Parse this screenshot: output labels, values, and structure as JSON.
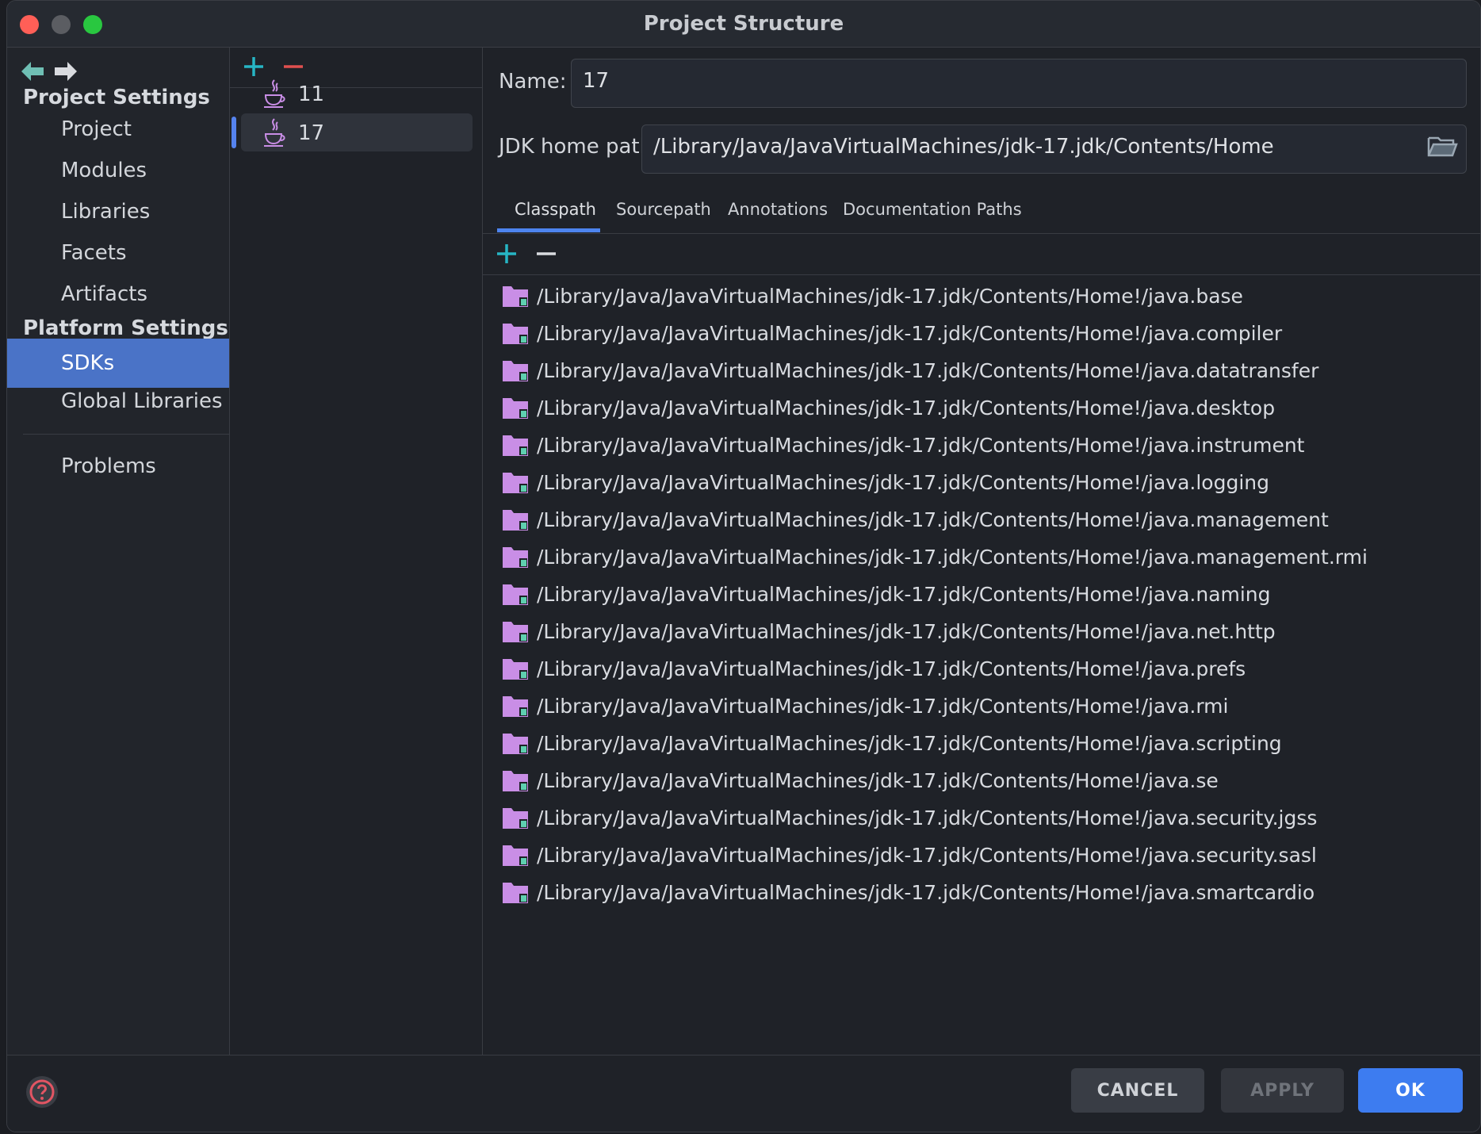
{
  "window": {
    "title": "Project Structure"
  },
  "sidebar": {
    "project_settings_heading": "Project Settings",
    "project_items": [
      "Project",
      "Modules",
      "Libraries",
      "Facets",
      "Artifacts"
    ],
    "platform_settings_heading": "Platform Settings",
    "platform_items": [
      "SDKs",
      "Global Libraries"
    ],
    "selected": "SDKs",
    "problems": "Problems"
  },
  "sdk_list": {
    "items": [
      "11",
      "17"
    ],
    "selected": "17"
  },
  "detail": {
    "name_label": "Name:",
    "name_value": "17",
    "jdk_home_label": "JDK home path:",
    "jdk_home_value": "/Library/Java/JavaVirtualMachines/jdk-17.jdk/Contents/Home",
    "tabs": [
      "Classpath",
      "Sourcepath",
      "Annotations",
      "Documentation Paths"
    ],
    "active_tab": "Classpath",
    "classpath": [
      "/Library/Java/JavaVirtualMachines/jdk-17.jdk/Contents/Home!/java.base",
      "/Library/Java/JavaVirtualMachines/jdk-17.jdk/Contents/Home!/java.compiler",
      "/Library/Java/JavaVirtualMachines/jdk-17.jdk/Contents/Home!/java.datatransfer",
      "/Library/Java/JavaVirtualMachines/jdk-17.jdk/Contents/Home!/java.desktop",
      "/Library/Java/JavaVirtualMachines/jdk-17.jdk/Contents/Home!/java.instrument",
      "/Library/Java/JavaVirtualMachines/jdk-17.jdk/Contents/Home!/java.logging",
      "/Library/Java/JavaVirtualMachines/jdk-17.jdk/Contents/Home!/java.management",
      "/Library/Java/JavaVirtualMachines/jdk-17.jdk/Contents/Home!/java.management.rmi",
      "/Library/Java/JavaVirtualMachines/jdk-17.jdk/Contents/Home!/java.naming",
      "/Library/Java/JavaVirtualMachines/jdk-17.jdk/Contents/Home!/java.net.http",
      "/Library/Java/JavaVirtualMachines/jdk-17.jdk/Contents/Home!/java.prefs",
      "/Library/Java/JavaVirtualMachines/jdk-17.jdk/Contents/Home!/java.rmi",
      "/Library/Java/JavaVirtualMachines/jdk-17.jdk/Contents/Home!/java.scripting",
      "/Library/Java/JavaVirtualMachines/jdk-17.jdk/Contents/Home!/java.se",
      "/Library/Java/JavaVirtualMachines/jdk-17.jdk/Contents/Home!/java.security.jgss",
      "/Library/Java/JavaVirtualMachines/jdk-17.jdk/Contents/Home!/java.security.sasl",
      "/Library/Java/JavaVirtualMachines/jdk-17.jdk/Contents/Home!/java.smartcardio"
    ]
  },
  "buttons": {
    "cancel": "CANCEL",
    "apply": "APPLY",
    "ok": "OK"
  },
  "colors": {
    "accent": "#3d7cf0",
    "selection": "#4a73c7",
    "add": "#27b5c4",
    "remove": "#e0504f",
    "folder": "#c98ee6"
  }
}
